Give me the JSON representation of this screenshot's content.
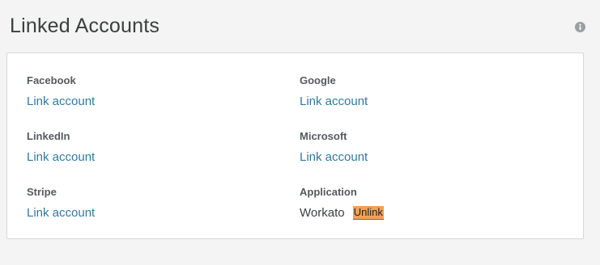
{
  "page": {
    "title": "Linked Accounts",
    "info_icon": "info-icon"
  },
  "accounts": [
    {
      "label": "Facebook",
      "action": "Link account"
    },
    {
      "label": "Google",
      "action": "Link account"
    },
    {
      "label": "LinkedIn",
      "action": "Link account"
    },
    {
      "label": "Microsoft",
      "action": "Link account"
    },
    {
      "label": "Stripe",
      "action": "Link account"
    },
    {
      "label": "Application",
      "linked_name": "Workato",
      "action": "Unlink"
    }
  ],
  "colors": {
    "background": "#f3f4f3",
    "card": "#ffffff",
    "link": "#2f7b9e",
    "unlink_highlight": "#f1a157",
    "label": "#545b5e",
    "title": "#3b3f40"
  }
}
